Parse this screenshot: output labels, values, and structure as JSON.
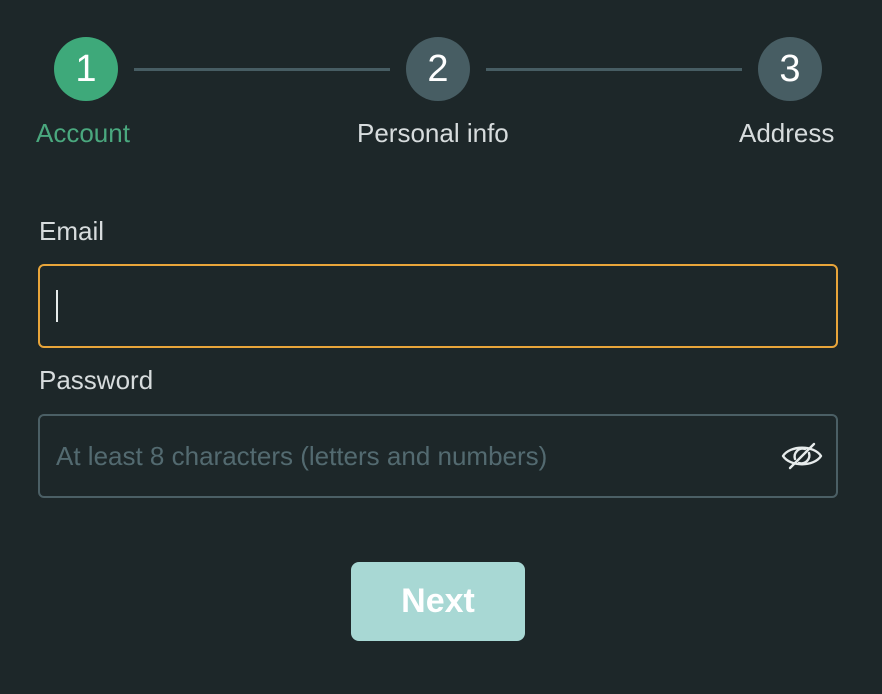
{
  "stepper": {
    "steps": [
      {
        "number": "1",
        "label": "Account",
        "state": "active"
      },
      {
        "number": "2",
        "label": "Personal info",
        "state": "inactive"
      },
      {
        "number": "3",
        "label": "Address",
        "state": "inactive"
      }
    ]
  },
  "form": {
    "email": {
      "label": "Email",
      "value": "",
      "placeholder": ""
    },
    "password": {
      "label": "Password",
      "value": "",
      "placeholder": "At least 8 characters (letters and numbers)",
      "toggle_icon": "eye-off-icon"
    },
    "next_label": "Next"
  },
  "colors": {
    "background": "#1d2729",
    "active_step": "#3ea97a",
    "inactive_step": "#475d63",
    "focus_border": "#e8a53a",
    "button_bg": "#a8d8d4"
  }
}
